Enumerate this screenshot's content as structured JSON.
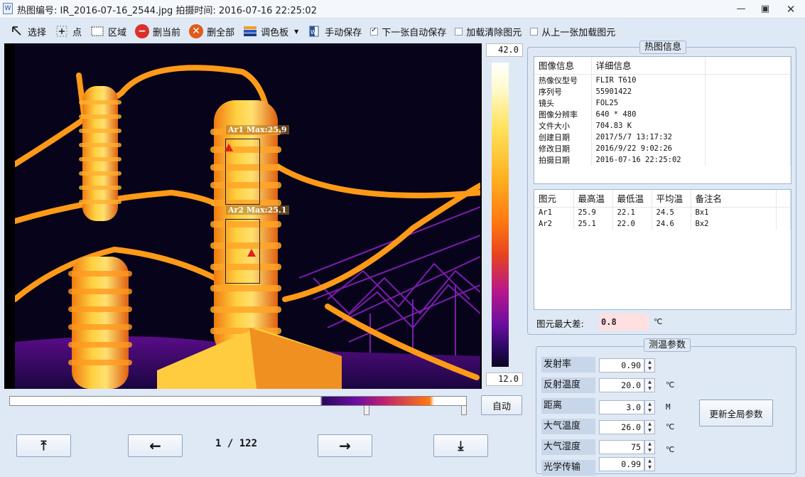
{
  "window": {
    "title": "热图编号: IR_2016-07-16_2544.jpg  拍摄时间: 2016-07-16 22:25:02",
    "icon": "W"
  },
  "toolbar": {
    "select": "选择",
    "point": "点",
    "area": "区域",
    "delete_current": "删当前",
    "delete_all": "删全部",
    "palette": "调色板",
    "manual_save": "手动保存",
    "auto_save_next": "下一张自动保存",
    "load_clear": "加载清除图元",
    "load_from_prev": "从上一张加载图元",
    "auto_save_next_checked": true,
    "load_clear_checked": false,
    "load_from_prev_checked": false
  },
  "thermal": {
    "rois": [
      {
        "label": "Ar1 Max:25.9"
      },
      {
        "label": "Ar2 Max:25.1"
      }
    ]
  },
  "scale": {
    "max": "42.0",
    "min": "12.0",
    "auto_button": "自动"
  },
  "navigation": {
    "page_indicator": "1 / 122",
    "first_icon": "⤒",
    "prev_icon": "←",
    "next_icon": "→",
    "last_icon": "⤓"
  },
  "info_panel": {
    "title": "热图信息",
    "headers": [
      "图像信息",
      "详细信息"
    ],
    "rows": [
      {
        "key": "热像仪型号",
        "value": "FLIR T610"
      },
      {
        "key": "序列号",
        "value": "55901422"
      },
      {
        "key": "镜头",
        "value": "FOL25"
      },
      {
        "key": "图像分辨率",
        "value": "640 * 480"
      },
      {
        "key": "文件大小",
        "value": "704.83 K"
      },
      {
        "key": "创建日期",
        "value": "2017/5/7 13:17:32"
      },
      {
        "key": "修改日期",
        "value": "2016/9/22 9:02:26"
      },
      {
        "key": "拍摄日期",
        "value": "2016-07-16 22:25:02"
      }
    ],
    "element_headers": [
      "图元",
      "最高温",
      "最低温",
      "平均温",
      "备注名"
    ],
    "elements": [
      {
        "name": "Ar1",
        "max": "25.9",
        "min": "22.1",
        "avg": "24.5",
        "note": "Bx1"
      },
      {
        "name": "Ar2",
        "max": "25.1",
        "min": "22.0",
        "avg": "24.6",
        "note": "Bx2"
      }
    ],
    "max_diff_label": "图元最大差:",
    "max_diff_value": "0.8",
    "max_diff_unit": "℃"
  },
  "params_panel": {
    "title": "测温参数",
    "params": [
      {
        "label": "发射率",
        "value": "0.90",
        "unit": ""
      },
      {
        "label": "反射温度",
        "value": "20.0",
        "unit": "℃"
      },
      {
        "label": "距离",
        "value": "3.0",
        "unit": "M"
      },
      {
        "label": "大气温度",
        "value": "26.0",
        "unit": "℃"
      },
      {
        "label": "大气湿度",
        "value": "75",
        "unit": "℃"
      },
      {
        "label": "光学传输",
        "value": "0.99",
        "unit": ""
      }
    ],
    "update_button": "更新全局参数"
  }
}
